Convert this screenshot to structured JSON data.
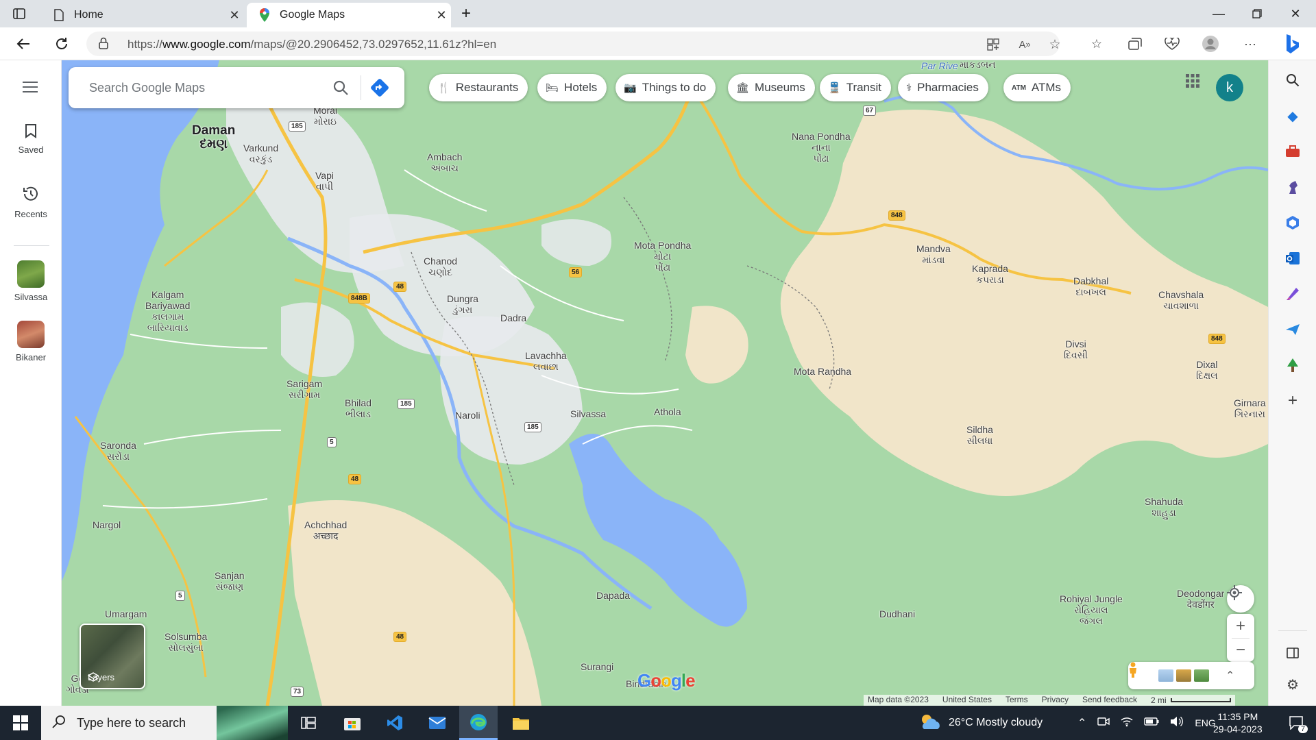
{
  "browser": {
    "tabs": [
      {
        "title": "Home"
      },
      {
        "title": "Google Maps"
      }
    ],
    "url_prefix": "https://",
    "url_domain": "www.google.com",
    "url_path": "/maps/@20.2906452,73.0297652,11.61z?hl=en"
  },
  "rail": {
    "saved_label": "Saved",
    "recents_label": "Recents",
    "places": [
      {
        "label": "Silvassa"
      },
      {
        "label": "Bikaner"
      }
    ]
  },
  "search": {
    "placeholder": "Search Google Maps"
  },
  "chips": [
    "Restaurants",
    "Hotels",
    "Things to do",
    "Museums",
    "Transit",
    "Pharmacies",
    "ATMs"
  ],
  "account": {
    "initial": "k"
  },
  "map_labels": {
    "daman": "Daman",
    "daman_gu": "દમણ",
    "morai": "Morai",
    "morai_gu": "મોરાઇ",
    "varkund": "Varkund",
    "varkund_gu": "વરકુંડ",
    "vapi": "Vapi",
    "vapi_gu": "વાપી",
    "ambach": "Ambach",
    "ambach_gu": "અંબાચ",
    "nana_pondha": "Nana Pondha",
    "nana_pondha_gu": "નાના",
    "nana_pondha_gu2": "પોંઢા",
    "makadban_gu": "માકડબન",
    "mandva": "Mandva",
    "mandva_gu": "માંડવા",
    "kaprada": "Kaprada",
    "kaprada_gu": "કપરાડા",
    "dabkhal": "Dabkhal",
    "dabkhal_gu": "દાબખલ",
    "chavshala": "Chavshala",
    "chavshala_gu": "ચાવશાળા",
    "chanod": "Chanod",
    "chanod_gu": "ચણોદ",
    "mota_pondha": "Mota Pondha",
    "mota_pondha_gu": "મોટા",
    "mota_pondha_gu2": "પોંઢા",
    "kalgam": "Kalgam",
    "bariyawad": "Bariyawad",
    "kalgam_gu": "કાલગામ",
    "bariyawad_gu": "બારિયાવાડ",
    "dungra": "Dungra",
    "dungra_gu": "ડુંગરા",
    "dadra": "Dadra",
    "lavachha": "Lavachha",
    "lavachha_gu": "લવાછા",
    "mota_randha": "Mota Randha",
    "divsi": "Divsi",
    "divsi_gu": "દિવસી",
    "dixal": "Dixal",
    "dixal_gu": "દિક્ષલ",
    "sarigam": "Sarigam",
    "sarigam_gu": "સરીગામ",
    "bhilad": "Bhilad",
    "bhilad_gu": "ભીલાડ",
    "naroli": "Naroli",
    "silvassa": "Silvassa",
    "athola": "Athola",
    "girnara": "Girnara",
    "girnara_gu": "ગિરનારા",
    "saronda": "Saronda",
    "saronda_gu": "સરોંડા",
    "sildha": "Sildha",
    "sildha_gu": "સીલધા",
    "nargol": "Nargol",
    "achchhad": "Achchhad",
    "achchhad_gu": "अच्छाद",
    "shahuda": "Shahuda",
    "shahuda_gu": "શાહુડા",
    "sanjan": "Sanjan",
    "sanjan_gu": "સંજાણ",
    "umargam": "Umargam",
    "dapada": "Dapada",
    "rohiyal": "Rohiyal Jungle",
    "rohiyal_gu": "રોહિયાલ",
    "rohiyal_gu2": "જંગલ",
    "deodongar": "Deodongar",
    "deodongar_gu": "देवडोंगर",
    "dudhani": "Dudhani",
    "solsumba": "Solsumba",
    "solsumba_gu": "સોલસુંબા",
    "surangi": "Surangi",
    "bindrabin": "Bindrabin",
    "go": "Go",
    "gowada_gu": "ગોવડા",
    "par_river": "Par Rive"
  },
  "shields": [
    "185",
    "185",
    "185",
    "67",
    "848",
    "848",
    "848B",
    "48",
    "48",
    "48",
    "56",
    "5",
    "5",
    "73"
  ],
  "layers_label": "Layers",
  "google_logo": "Google",
  "footer": {
    "map_data": "Map data ©2023",
    "country": "United States",
    "terms": "Terms",
    "privacy": "Privacy",
    "feedback": "Send feedback",
    "scale": "2 mi"
  },
  "taskbar": {
    "search_placeholder": "Type here to search",
    "weather": "26°C  Mostly cloudy",
    "lang": "ENG",
    "time": "11:35 PM",
    "date": "29-04-2023",
    "notif_count": "7"
  },
  "colors": {
    "park_green": "#a8d8a8",
    "urban": "#e8eaed",
    "water": "#8ab4f8",
    "highway": "#f6c343",
    "hills": "#f1e5c9"
  }
}
